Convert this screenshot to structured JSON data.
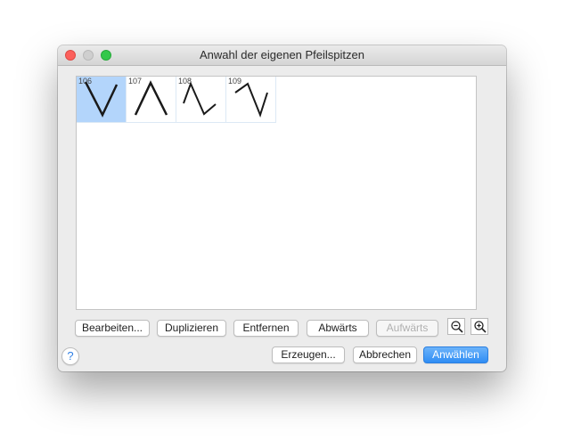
{
  "window": {
    "title": "Anwahl der eigenen Pfeilspitzen"
  },
  "arrowheads": [
    {
      "label": "106",
      "selected": true
    },
    {
      "label": "107",
      "selected": false
    },
    {
      "label": "108",
      "selected": false
    },
    {
      "label": "109",
      "selected": false
    }
  ],
  "toolbar": {
    "edit_label": "Bearbeiten...",
    "duplicate_label": "Duplizieren",
    "remove_label": "Entfernen",
    "down_label": "Abwärts",
    "up_label": "Aufwärts",
    "zoom_out_icon": "zoom-out-icon",
    "zoom_in_icon": "zoom-in-icon"
  },
  "footer": {
    "help_label": "?",
    "create_label": "Erzeugen...",
    "cancel_label": "Abbrechen",
    "choose_label": "Anwählen"
  },
  "colors": {
    "selection": "#b3d5fb",
    "accent": "#2f8df4"
  }
}
